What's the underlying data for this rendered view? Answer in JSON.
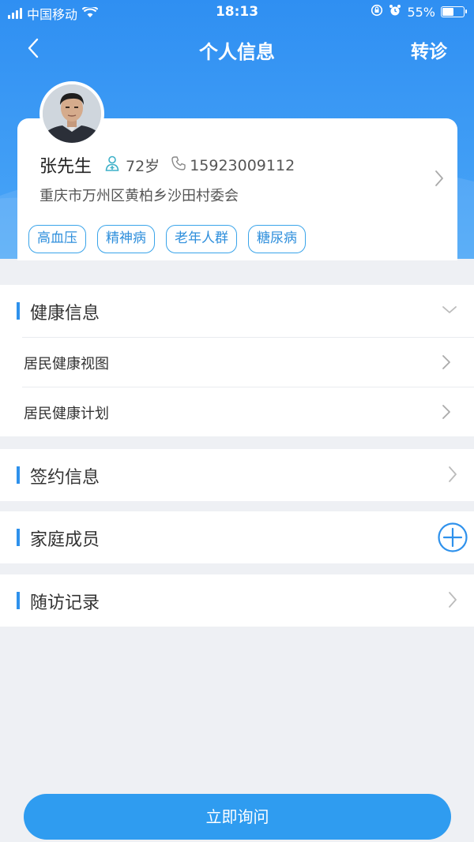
{
  "status_bar": {
    "carrier": "中国移动",
    "time": "18:13",
    "battery": "55%",
    "battery_level": 0.55
  },
  "nav": {
    "title": "个人信息",
    "action": "转诊",
    "back_icon": "chevron-left-icon"
  },
  "profile": {
    "name": "张先生",
    "age": "72岁",
    "phone": "15923009112",
    "address": "重庆市万州区黄柏乡沙田村委会",
    "tags": [
      "高血压",
      "精神病",
      "老年人群",
      "糖尿病"
    ]
  },
  "sections": {
    "health": {
      "title": "健康信息",
      "items": [
        "居民健康视图",
        "居民健康计划"
      ]
    },
    "contract": {
      "title": "签约信息"
    },
    "family": {
      "title": "家庭成员"
    },
    "followup": {
      "title": "随访记录"
    }
  },
  "footer": {
    "ask_label": "立即询问"
  },
  "colors": {
    "primary": "#2f8ff2",
    "accent_blue": "#2e91ec",
    "tag_border": "#39a4ea",
    "background": "#eef0f4"
  }
}
